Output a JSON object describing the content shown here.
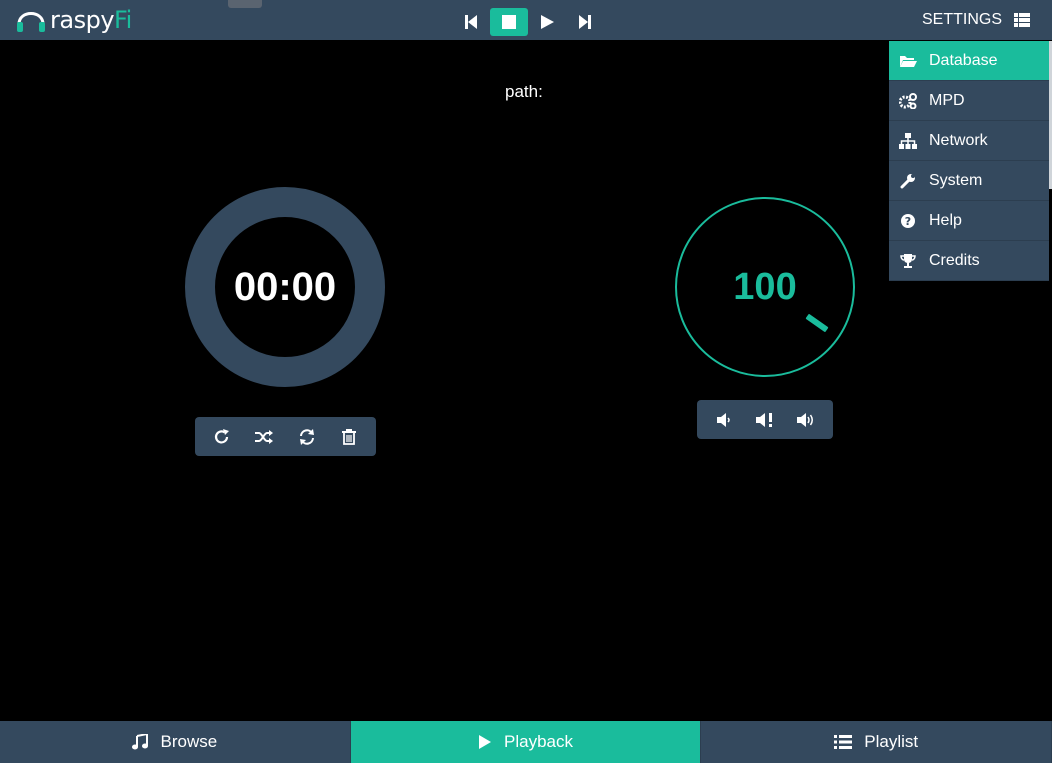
{
  "app": {
    "logo_text_prefix": "rasp",
    "logo_text_mid": "y",
    "logo_text_suffix": "Fi"
  },
  "header": {
    "settings_label": "SETTINGS"
  },
  "settings_menu": {
    "items": [
      {
        "label": "Database",
        "icon": "folder-open-icon",
        "active": true
      },
      {
        "label": "MPD",
        "icon": "cogs-icon",
        "active": false
      },
      {
        "label": "Network",
        "icon": "sitemap-icon",
        "active": false
      },
      {
        "label": "System",
        "icon": "wrench-icon",
        "active": false
      },
      {
        "label": "Help",
        "icon": "question-circle-icon",
        "active": false
      },
      {
        "label": "Credits",
        "icon": "trophy-icon",
        "active": false
      }
    ]
  },
  "playback": {
    "path_label": "path:",
    "elapsed": "00:00",
    "volume": "100"
  },
  "bottom_nav": {
    "browse": "Browse",
    "playback": "Playback",
    "playlist": "Playlist"
  },
  "colors": {
    "accent": "#1abc9c",
    "panel": "#34495e",
    "background": "#000000"
  }
}
